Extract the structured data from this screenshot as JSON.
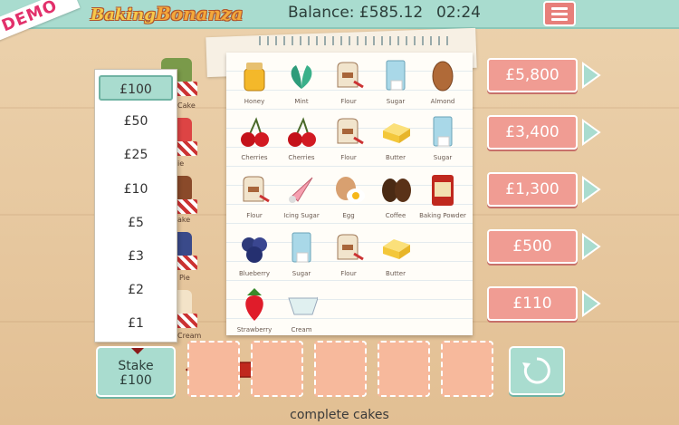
{
  "header": {
    "demo_badge": "DEMO",
    "logo_part1": "Baking",
    "logo_part2": "Bonanza",
    "balance": "Balance: £585.12",
    "clock": "02:24"
  },
  "background_cakes": [
    {
      "label": "Cake"
    },
    {
      "label": "ie"
    },
    {
      "label": "ake"
    },
    {
      "label": "Pie"
    },
    {
      "label": "Cream"
    }
  ],
  "ingredients": [
    {
      "label": "Honey",
      "icon": "honey-jar-icon"
    },
    {
      "label": "Mint",
      "icon": "mint-leaves-icon"
    },
    {
      "label": "Flour",
      "icon": "flour-sack-icon"
    },
    {
      "label": "Sugar",
      "icon": "sugar-bag-icon"
    },
    {
      "label": "Almond",
      "icon": "almond-icon"
    },
    {
      "label": "Cherries",
      "icon": "cherries-icon"
    },
    {
      "label": "Cherries",
      "icon": "cherries-icon"
    },
    {
      "label": "Flour",
      "icon": "flour-sack-icon"
    },
    {
      "label": "Butter",
      "icon": "butter-icon"
    },
    {
      "label": "Sugar",
      "icon": "sugar-bag-icon"
    },
    {
      "label": "Flour",
      "icon": "flour-sack-icon"
    },
    {
      "label": "Icing Sugar",
      "icon": "piping-bag-icon"
    },
    {
      "label": "Egg",
      "icon": "egg-icon"
    },
    {
      "label": "Coffee",
      "icon": "coffee-beans-icon"
    },
    {
      "label": "Baking Powder",
      "icon": "baking-powder-icon"
    },
    {
      "label": "Blueberry",
      "icon": "blueberry-icon"
    },
    {
      "label": "Sugar",
      "icon": "sugar-bag-icon"
    },
    {
      "label": "Flour",
      "icon": "flour-sack-icon"
    },
    {
      "label": "Butter",
      "icon": "butter-icon"
    },
    {
      "label": "Strawberry",
      "icon": "strawberry-icon"
    },
    {
      "label": "Cream",
      "icon": "cream-jug-icon"
    }
  ],
  "stake": {
    "options": [
      "£100",
      "£50",
      "£25",
      "£10",
      "£5",
      "£3",
      "£2",
      "£1"
    ],
    "selected_index": 0,
    "button_label": "Stake",
    "button_value": "£100"
  },
  "prizes": [
    "£5,800",
    "£3,400",
    "£1,300",
    "£500",
    "£110"
  ],
  "footer": {
    "complete_label": "complete cakes"
  },
  "colors": {
    "accent_teal": "#a9dccf",
    "prize_pink": "#f09c93",
    "slot_peach": "#f7b99c",
    "arrow_red": "#c0281e"
  }
}
